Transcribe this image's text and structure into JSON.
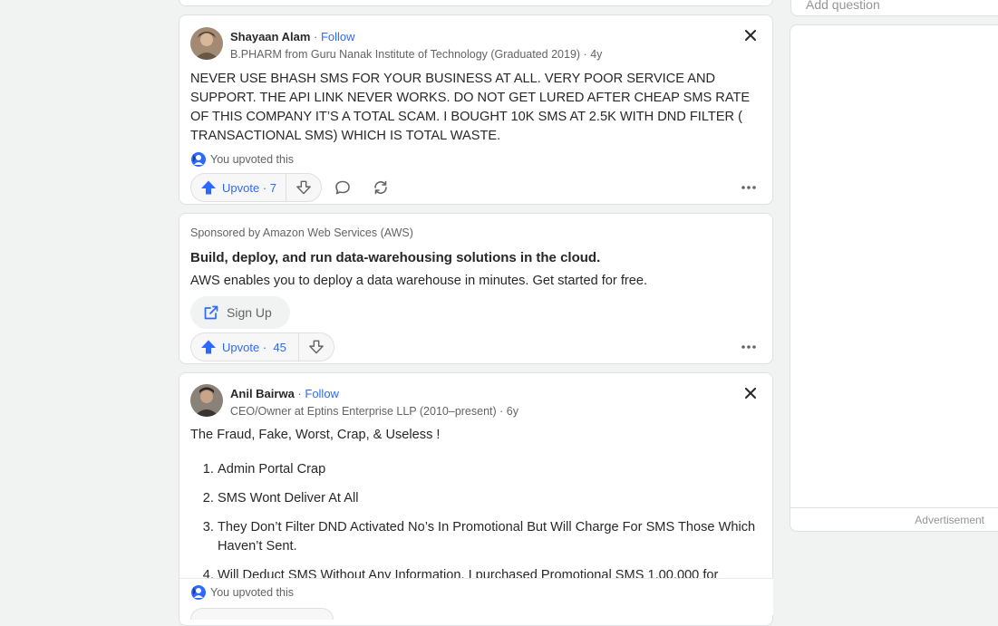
{
  "sidebar": {
    "add_question_placeholder": "Add question",
    "advertisement_label": "Advertisement"
  },
  "post1": {
    "author": "Shayaan Alam",
    "follow_label": "Follow",
    "credential": "B.PHARM from Guru Nanak Institute of Technology (Graduated 2019)",
    "age": "4y",
    "body": "NEVER USE BHASH SMS FOR YOUR BUSINESS AT ALL. VERY POOR SERVICE AND SUPPORT. THE API LINK NEVER WORKS. DO NOT GET LURED AFTER CHEAP SMS RATE OF THIS COMPANY IT’S A TOTAL SCAM. I BOUGHT 10K SMS AT 2.5K WITH DND FILTER ( TRANSACTIONAL SMS) WHICH IS TOTAL WASTE.",
    "upvoted_note": "You upvoted this",
    "upvote_label": "Upvote",
    "upvote_count": "7"
  },
  "ad": {
    "sponsor": "Sponsored by Amazon Web Services (AWS)",
    "title": "Build, deploy, and run data-warehousing solutions in the cloud.",
    "description": "AWS enables you to deploy a data warehouse in minutes. Get started for free.",
    "cta_label": "Sign Up",
    "upvote_label": "Upvote",
    "upvote_count": "45"
  },
  "post2": {
    "author": "Anil Bairwa",
    "follow_label": "Follow",
    "credential": "CEO/Owner at Eptins Enterprise LLP (2010–present)",
    "age": "6y",
    "intro": "The Fraud, Fake, Worst, Crap, & Useless !",
    "list": [
      "Admin Portal Crap",
      "SMS Wont Deliver At All",
      "They Don’t Filter DND Activated No’s In Promotional But Will Charge For SMS Those Which Haven’t Sent.",
      "Will Deduct SMS Without Any Information, I purchased Promotional SMS 1,00,000 for"
    ],
    "upvoted_note": "You upvoted this"
  },
  "colors": {
    "accent": "#2e69ff",
    "background": "#f1f2f2",
    "text": "#282829",
    "muted": "#636466"
  }
}
